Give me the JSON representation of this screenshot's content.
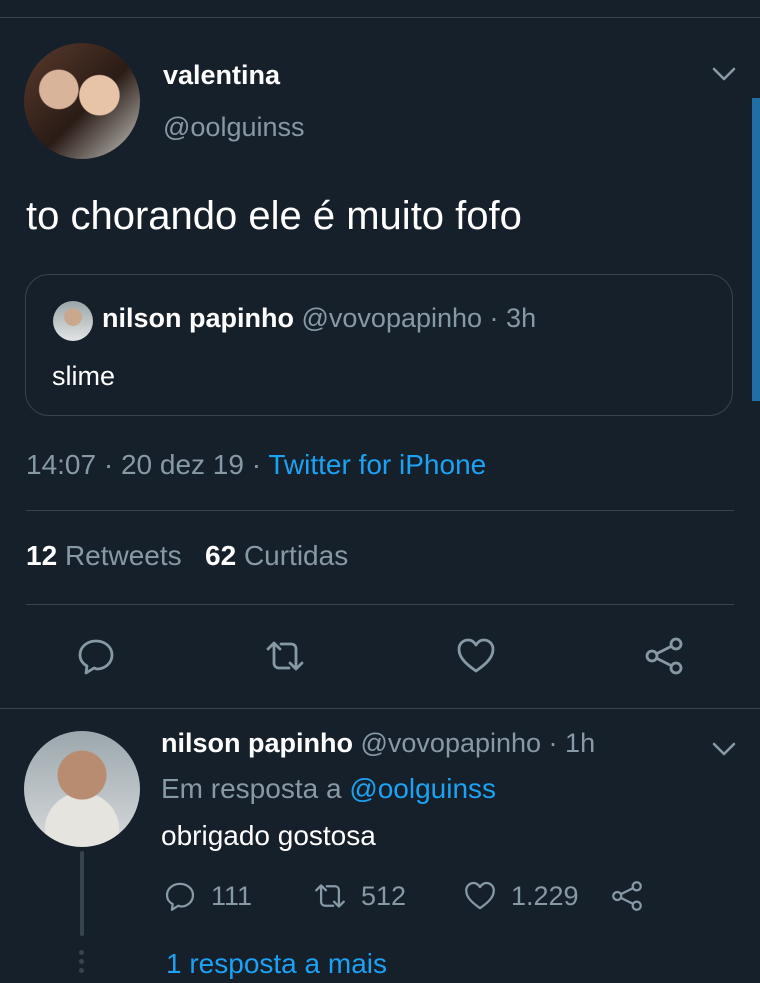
{
  "tweet": {
    "author_name": "valentina",
    "author_handle": "@oolguinss",
    "text": "to chorando ele é muito fofo",
    "timestamp": "14:07 · 20 dez 19",
    "separator": " · ",
    "source": "Twitter for iPhone",
    "stats": {
      "retweets_count": "12",
      "retweets_label": "Retweets",
      "likes_count": "62",
      "likes_label": "Curtidas"
    }
  },
  "quoted_tweet": {
    "author_name": "nilson papinho",
    "author_handle": "@vovopapinho",
    "separator": " · ",
    "time": "3h",
    "text": "slime"
  },
  "reply": {
    "author_name": "nilson papinho",
    "author_handle": "@vovopapinho",
    "separator": " · ",
    "time": "1h",
    "reply_to_label": "Em resposta a",
    "reply_to_mention": "@oolguinss",
    "text": "obrigado gostosa",
    "reply_count": "111",
    "retweet_count": "512",
    "like_count": "1.229",
    "more_replies": "1 resposta a mais"
  },
  "colors": {
    "background": "#15202b",
    "secondary_text": "#8899a6",
    "accent": "#1da1f2",
    "divider": "#38444d"
  },
  "icons": [
    "chevron-down-icon",
    "reply-icon",
    "retweet-icon",
    "like-icon",
    "share-icon"
  ]
}
